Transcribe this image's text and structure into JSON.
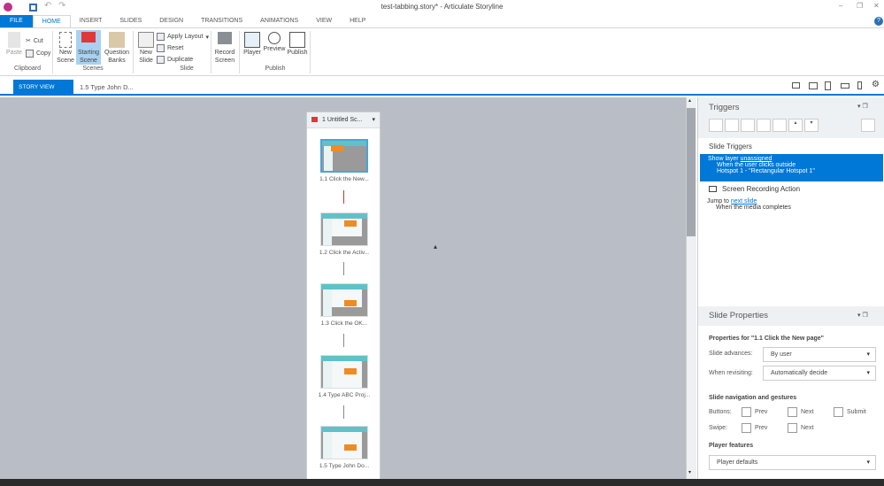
{
  "app": {
    "title": "test-tabbing.story* - Articulate Storyline"
  },
  "tabs": [
    "FILE",
    "HOME",
    "INSERT",
    "SLIDES",
    "DESIGN",
    "TRANSITIONS",
    "ANIMATIONS",
    "VIEW",
    "HELP"
  ],
  "ribbon": {
    "paste": "Paste",
    "cut": "Cut",
    "copy": "Copy",
    "clipboard": "Clipboard",
    "new_scene": "New Scene",
    "starting_scene": "Starting Scene",
    "question_banks": "Question Banks",
    "scenes": "Scenes",
    "new_slide": "New Slide",
    "apply_layout": "Apply Layout",
    "reset": "Reset",
    "duplicate": "Duplicate",
    "slide": "Slide",
    "record_screen": "Record Screen",
    "player": "Player",
    "preview": "Preview",
    "publish": "Publish",
    "publish_group": "Publish"
  },
  "viewbar": {
    "story_view": "STORY VIEW",
    "slide_tab": "1.5 Type John D..."
  },
  "scene": {
    "title": "1 Untitled Sc...",
    "slides": [
      "1.1 Click the New...",
      "1.2 Click the Activ...",
      "1.3 Click the OK...",
      "1.4 Type ABC Proj...",
      "1.5 Type John Do..."
    ]
  },
  "triggers": {
    "title": "Triggers",
    "section": "Slide Triggers",
    "t1_action": "Show layer",
    "t1_link": "unassigned",
    "t1_when": "When the user clicks outside",
    "t1_obj": "Hotspot 1 - \"Rectangular Hotspot 1\"",
    "group2": "Screen Recording Action",
    "t2_action": "Jump to",
    "t2_link": "next slide",
    "t2_when": "When the media completes"
  },
  "props": {
    "title": "Slide Properties",
    "for": "Properties for \"1.1 Click the New page\"",
    "advances_label": "Slide advances:",
    "advances": "By user",
    "revisit_label": "When revisiting:",
    "revisit": "Automatically decide",
    "nav_title": "Slide navigation and gestures",
    "buttons_label": "Buttons:",
    "swipe_label": "Swipe:",
    "prev": "Prev",
    "next": "Next",
    "submit": "Submit",
    "player_title": "Player features",
    "player": "Player defaults"
  }
}
